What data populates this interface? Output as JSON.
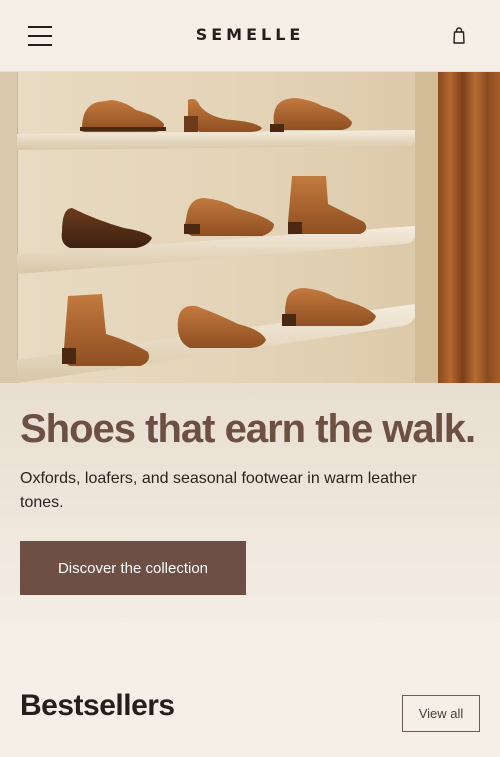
{
  "header": {
    "brand": "SEMELLE",
    "icons": {
      "menu": "menu-icon",
      "cart": "shopping-bag-icon"
    }
  },
  "hero": {
    "image": "Shoes displayed on three wall shelves beside a brown curtain",
    "headline": "Shoes that earn the walk.",
    "subcopy": "Oxfords, loafers, and seasonal footwear in warm leather tones.",
    "cta_label": "Discover the collection"
  },
  "bestsellers": {
    "title": "Bestsellers",
    "view_all_label": "View all"
  },
  "colors": {
    "background": "#f5efe7",
    "accent": "#6e4f43",
    "leather": "#a8612e"
  }
}
